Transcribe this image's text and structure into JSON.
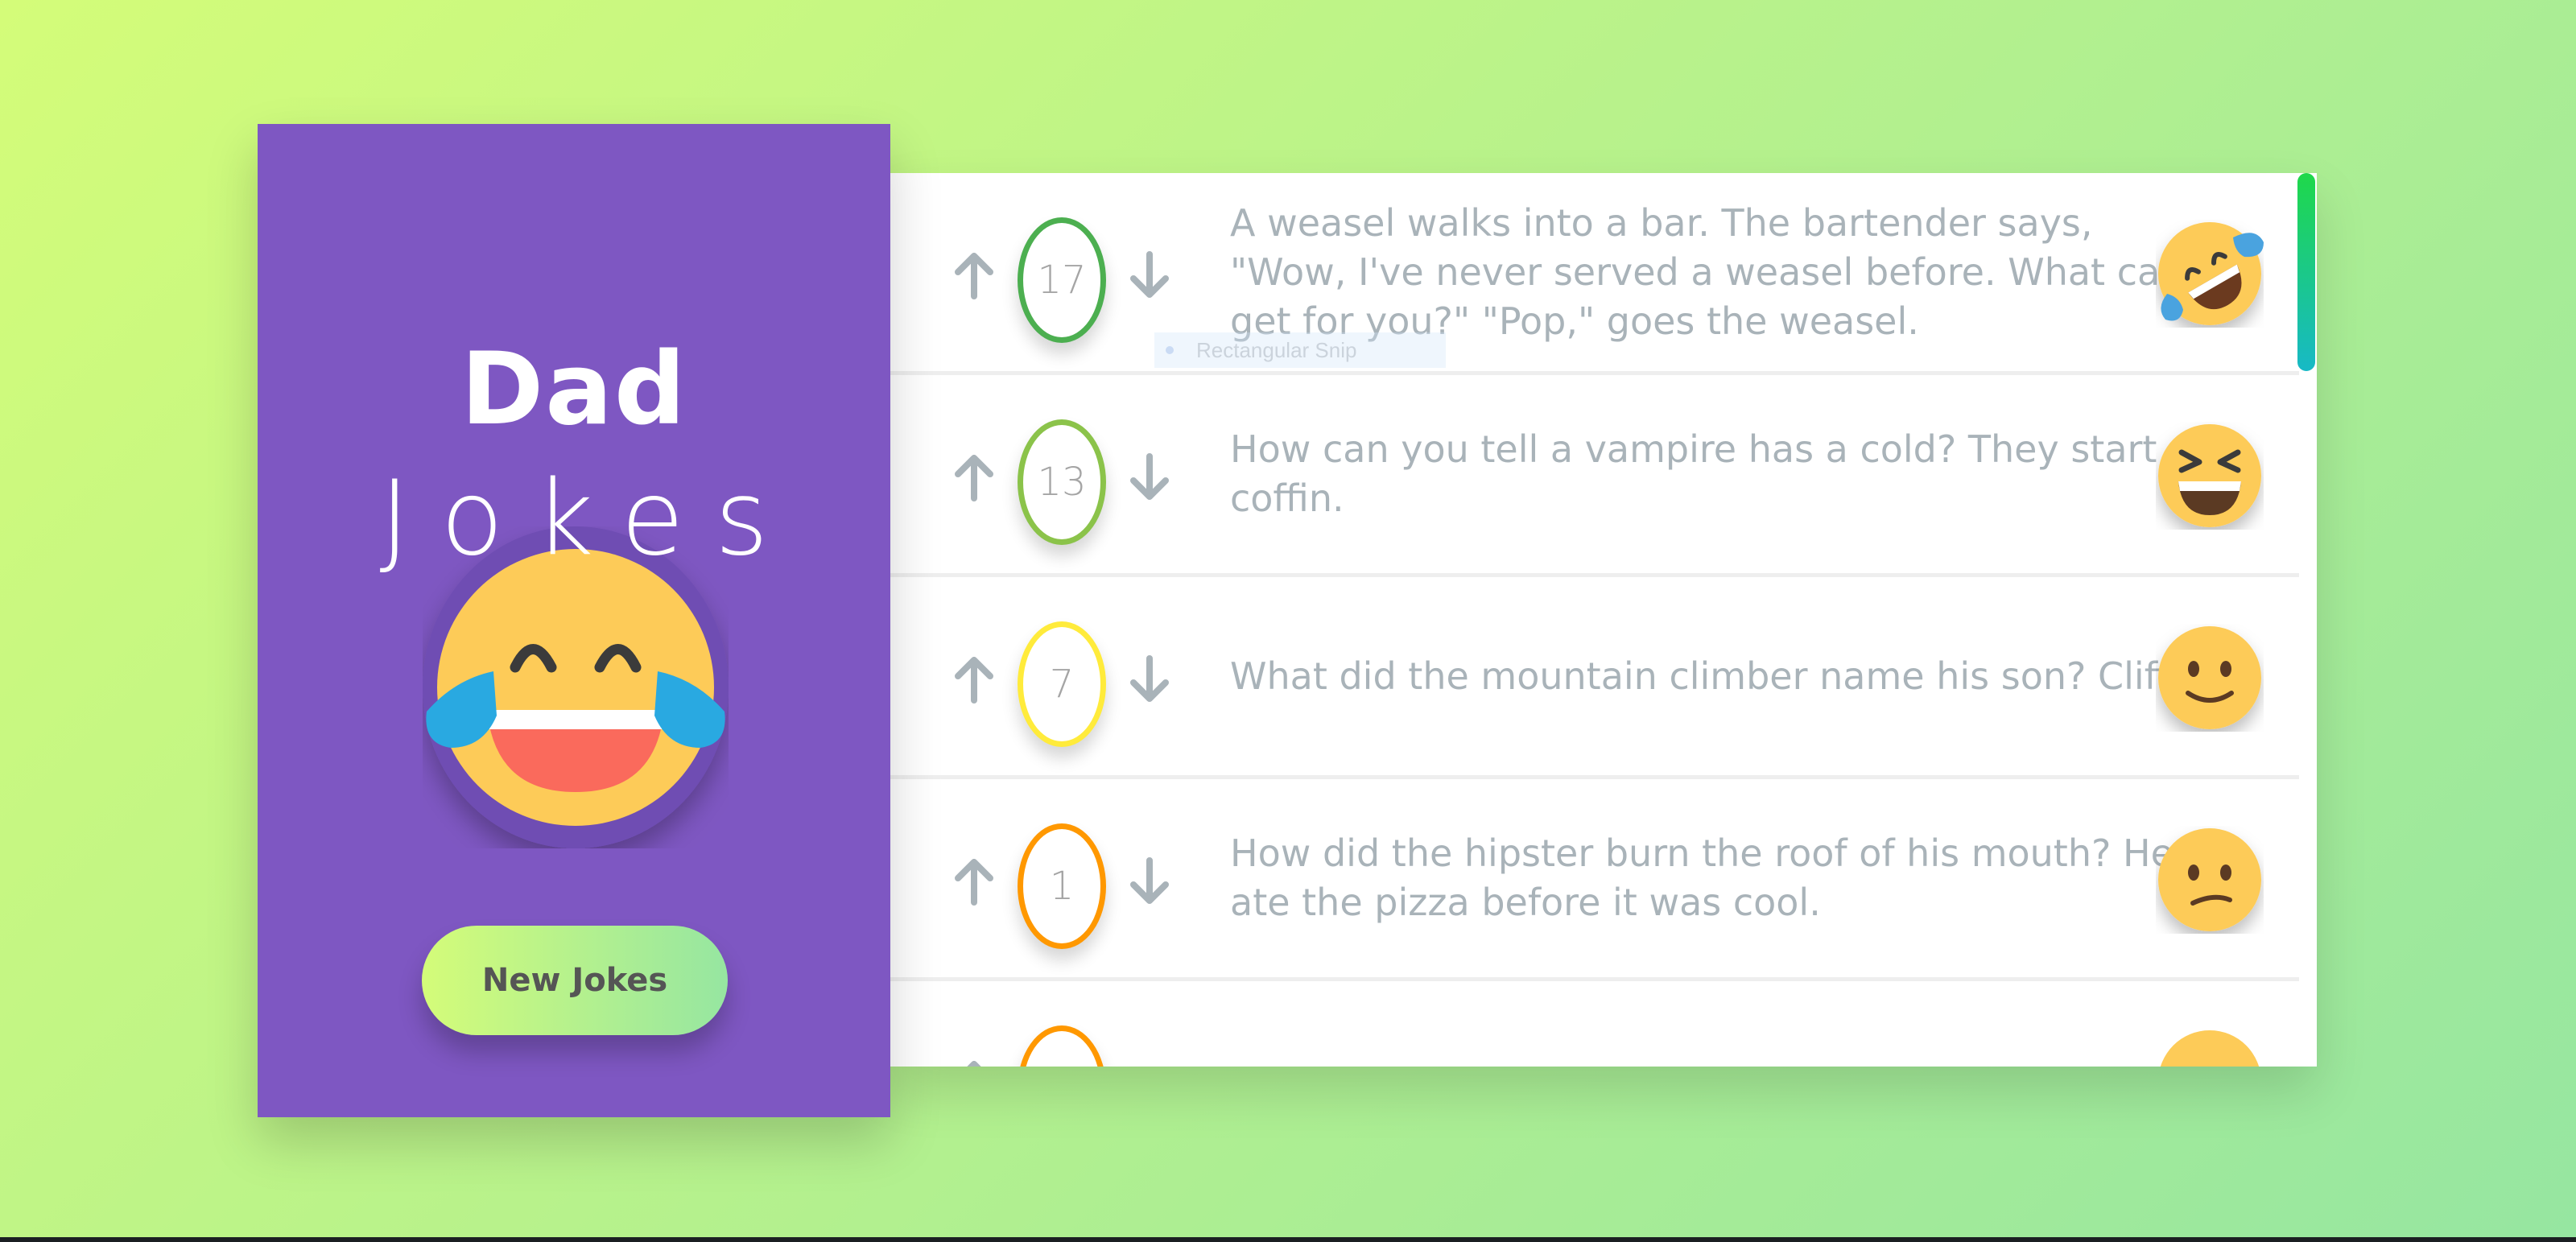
{
  "app": {
    "title_line1": "Dad",
    "title_line2": "Jokes",
    "new_jokes_label": "New Jokes"
  },
  "colors": {
    "background_start": "#d4fc79",
    "background_end": "#96e6a1",
    "sidebar": "#7e57c2",
    "joke_text": "#a9b3b9",
    "vote_colors": [
      "#4caf50",
      "#8bc34a",
      "#ffeb3b",
      "#ff9800",
      "#ff9800"
    ]
  },
  "tooltip": {
    "label": "Rectangular Snip"
  },
  "jokes": [
    {
      "votes": "17",
      "text": "A weasel walks into a bar. The bartender says, \"Wow, I've never served a weasel before. What can I get for you?\" \"Pop,\" goes the weasel.",
      "emoji": "rolling-on-floor-laughing-icon",
      "vote_color": "#4caf50"
    },
    {
      "votes": "13",
      "text": "How can you tell a vampire has a cold? They start coffin.",
      "emoji": "grinning-squinting-icon",
      "vote_color": "#8bc34a"
    },
    {
      "votes": "7",
      "text": "What did the mountain climber name his son? Cliff.",
      "emoji": "slightly-smiling-icon",
      "vote_color": "#ffeb3b"
    },
    {
      "votes": "1",
      "text": "How did the hipster burn the roof of his mouth? He ate the pizza before it was cool.",
      "emoji": "confused-face-icon",
      "vote_color": "#ff9800"
    },
    {
      "votes": "",
      "text": "",
      "emoji": "emoji-icon",
      "vote_color": "#ff9800"
    }
  ]
}
